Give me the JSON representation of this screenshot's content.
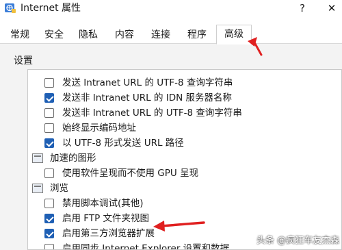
{
  "window": {
    "title": "Internet 属性",
    "help_label": "?",
    "close_label": "✕",
    "icon": "internet-options-icon"
  },
  "tabs": [
    {
      "label": "常规",
      "active": false
    },
    {
      "label": "安全",
      "active": false
    },
    {
      "label": "隐私",
      "active": false
    },
    {
      "label": "内容",
      "active": false
    },
    {
      "label": "连接",
      "active": false
    },
    {
      "label": "程序",
      "active": false
    },
    {
      "label": "高级",
      "active": true
    }
  ],
  "settings": {
    "group_label": "设置",
    "items": [
      {
        "type": "checkbox",
        "checked": false,
        "label": "发送 Intranet URL 的 UTF-8 查询字符串"
      },
      {
        "type": "checkbox",
        "checked": true,
        "label": "发送非 Intranet URL 的 IDN 服务器名称"
      },
      {
        "type": "checkbox",
        "checked": false,
        "label": "发送非 Intranet URL 的 UTF-8 查询字符串"
      },
      {
        "type": "checkbox",
        "checked": false,
        "label": "始终显示编码地址"
      },
      {
        "type": "checkbox",
        "checked": true,
        "label": "以 UTF-8 形式发送 URL 路径"
      },
      {
        "type": "group",
        "label": "加速的图形",
        "icon": "graphics-group-icon"
      },
      {
        "type": "checkbox",
        "checked": false,
        "label": "使用软件呈现而不使用 GPU 呈现"
      },
      {
        "type": "group",
        "label": "浏览",
        "icon": "browsing-group-icon"
      },
      {
        "type": "checkbox",
        "checked": false,
        "label": "禁用脚本调试(其他)"
      },
      {
        "type": "checkbox",
        "checked": true,
        "label": "启用 FTP 文件夹视图"
      },
      {
        "type": "checkbox",
        "checked": true,
        "label": "启用第三方浏览器扩展"
      },
      {
        "type": "checkbox",
        "checked": false,
        "label": "启用同步 Internet Explorer 设置和数据"
      }
    ]
  },
  "annotation": {
    "arrow_color": "#e02020"
  },
  "watermark": "头条 @疯狂车友杰森"
}
